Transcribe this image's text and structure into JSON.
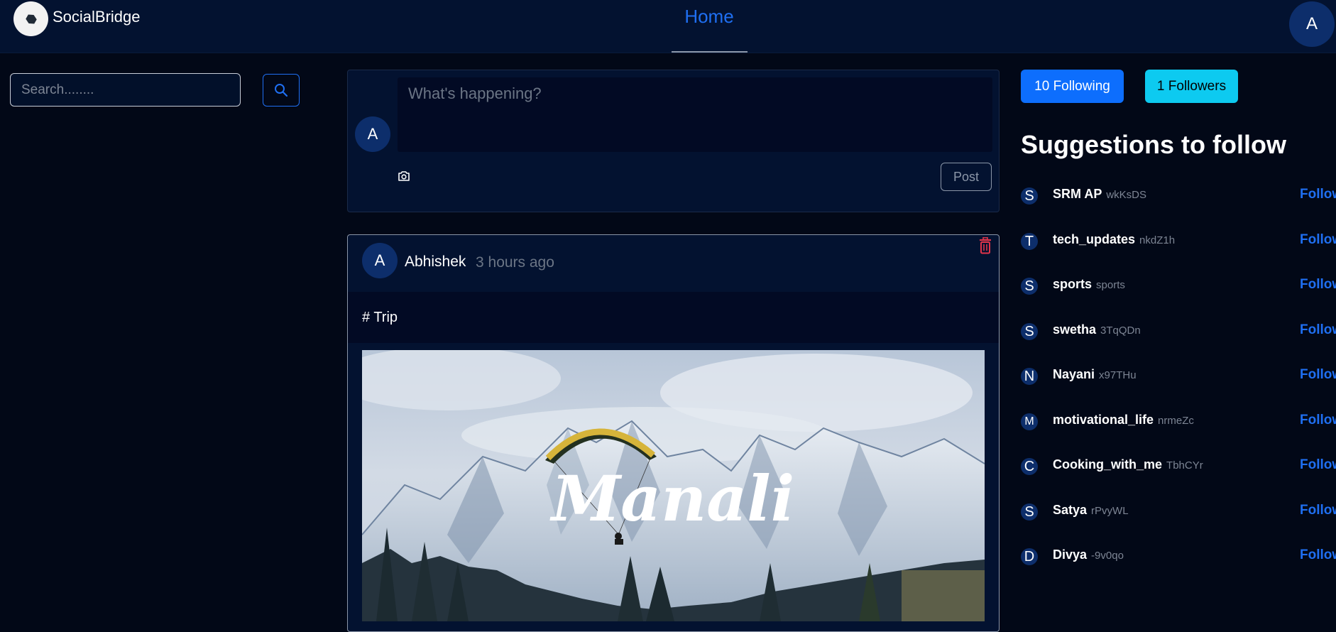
{
  "header": {
    "brand": "SocialBridge",
    "nav_home": "Home",
    "user_initial": "A"
  },
  "search": {
    "placeholder": "Search........"
  },
  "composer": {
    "user_initial": "A",
    "placeholder": "What's happening?",
    "post_label": "Post"
  },
  "post": {
    "author_initial": "A",
    "author": "Abhishek",
    "time": "3 hours ago",
    "text": "# Trip",
    "image_caption": "Manali"
  },
  "profile_stats": {
    "following": "10 Following",
    "followers": "1 Followers"
  },
  "suggestions": {
    "title": "Suggestions to follow",
    "follow_label": "Follow",
    "items": [
      {
        "initial": "S",
        "name": "SRM AP",
        "handle": "wkKsDS"
      },
      {
        "initial": "T",
        "name": "tech_updates",
        "handle": "nkdZ1h"
      },
      {
        "initial": "S",
        "name": "sports",
        "handle": "sports"
      },
      {
        "initial": "S",
        "name": "swetha",
        "handle": "3TqQDn"
      },
      {
        "initial": "N",
        "name": "Nayani",
        "handle": "x97THu"
      },
      {
        "initial": "M",
        "name": "motivational_life",
        "handle": "nrmeZc"
      },
      {
        "initial": "C",
        "name": "Cooking_with_me",
        "handle": "TbhCYr"
      },
      {
        "initial": "S",
        "name": "Satya",
        "handle": "rPvyWL"
      },
      {
        "initial": "D",
        "name": "Divya",
        "handle": "-9v0qo"
      }
    ]
  },
  "colors": {
    "background": "#020817",
    "panel": "#031230",
    "accent": "#1f6ff2",
    "following_btn": "#0d6efd",
    "followers_btn": "#0dcaf0",
    "delete": "#e0344a"
  }
}
